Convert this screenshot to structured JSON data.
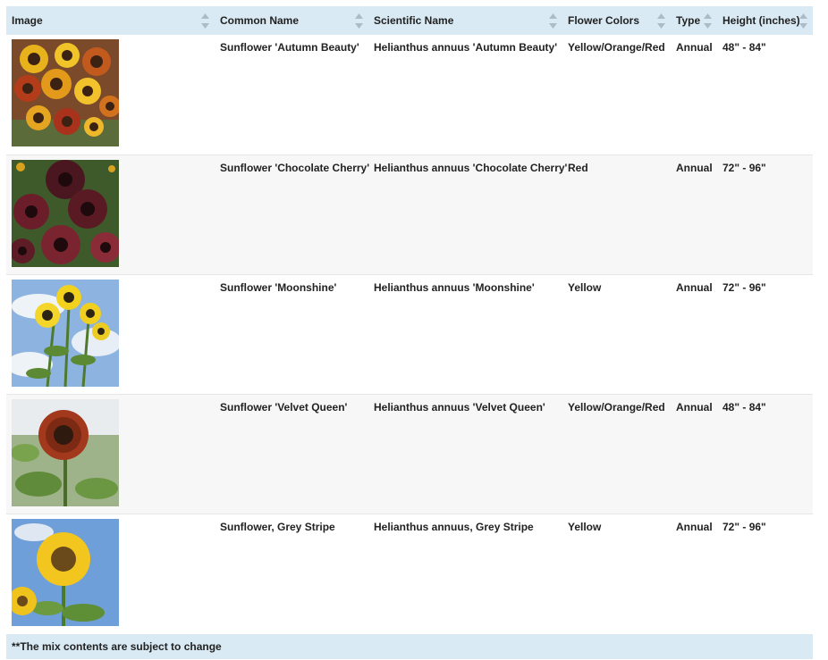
{
  "table": {
    "headers": {
      "image": "Image",
      "common_name": "Common Name",
      "scientific_name": "Scientific Name",
      "flower_colors": "Flower Colors",
      "type": "Type",
      "height": "Height (inches)"
    },
    "rows": [
      {
        "image_alt": "sunflower-autumn-beauty-photo",
        "common_name": "Sunflower 'Autumn Beauty'",
        "scientific_name": "Helianthus annuus 'Autumn Beauty'",
        "flower_colors": "Yellow/Orange/Red",
        "type": "Annual",
        "height": "48\" - 84\""
      },
      {
        "image_alt": "sunflower-chocolate-cherry-photo",
        "common_name": "Sunflower 'Chocolate Cherry'",
        "scientific_name": "Helianthus annuus 'Chocolate Cherry'",
        "flower_colors": "Red",
        "type": "Annual",
        "height": "72\" - 96\""
      },
      {
        "image_alt": "sunflower-moonshine-photo",
        "common_name": "Sunflower 'Moonshine'",
        "scientific_name": "Helianthus annuus 'Moonshine'",
        "flower_colors": "Yellow",
        "type": "Annual",
        "height": "72\" - 96\""
      },
      {
        "image_alt": "sunflower-velvet-queen-photo",
        "common_name": "Sunflower 'Velvet Queen'",
        "scientific_name": "Helianthus annuus 'Velvet Queen'",
        "flower_colors": "Yellow/Orange/Red",
        "type": "Annual",
        "height": "48\" - 84\""
      },
      {
        "image_alt": "sunflower-grey-stripe-photo",
        "common_name": "Sunflower, Grey Stripe",
        "scientific_name": "Helianthus annuus, Grey Stripe",
        "flower_colors": "Yellow",
        "type": "Annual",
        "height": "72\" - 96\""
      }
    ],
    "footer_note": "**The mix contents are subject to change"
  },
  "colors": {
    "header_bg": "#d9eaf4",
    "sort_arrow": "#a9bcc8",
    "row_alt_bg": "#f7f7f7"
  }
}
